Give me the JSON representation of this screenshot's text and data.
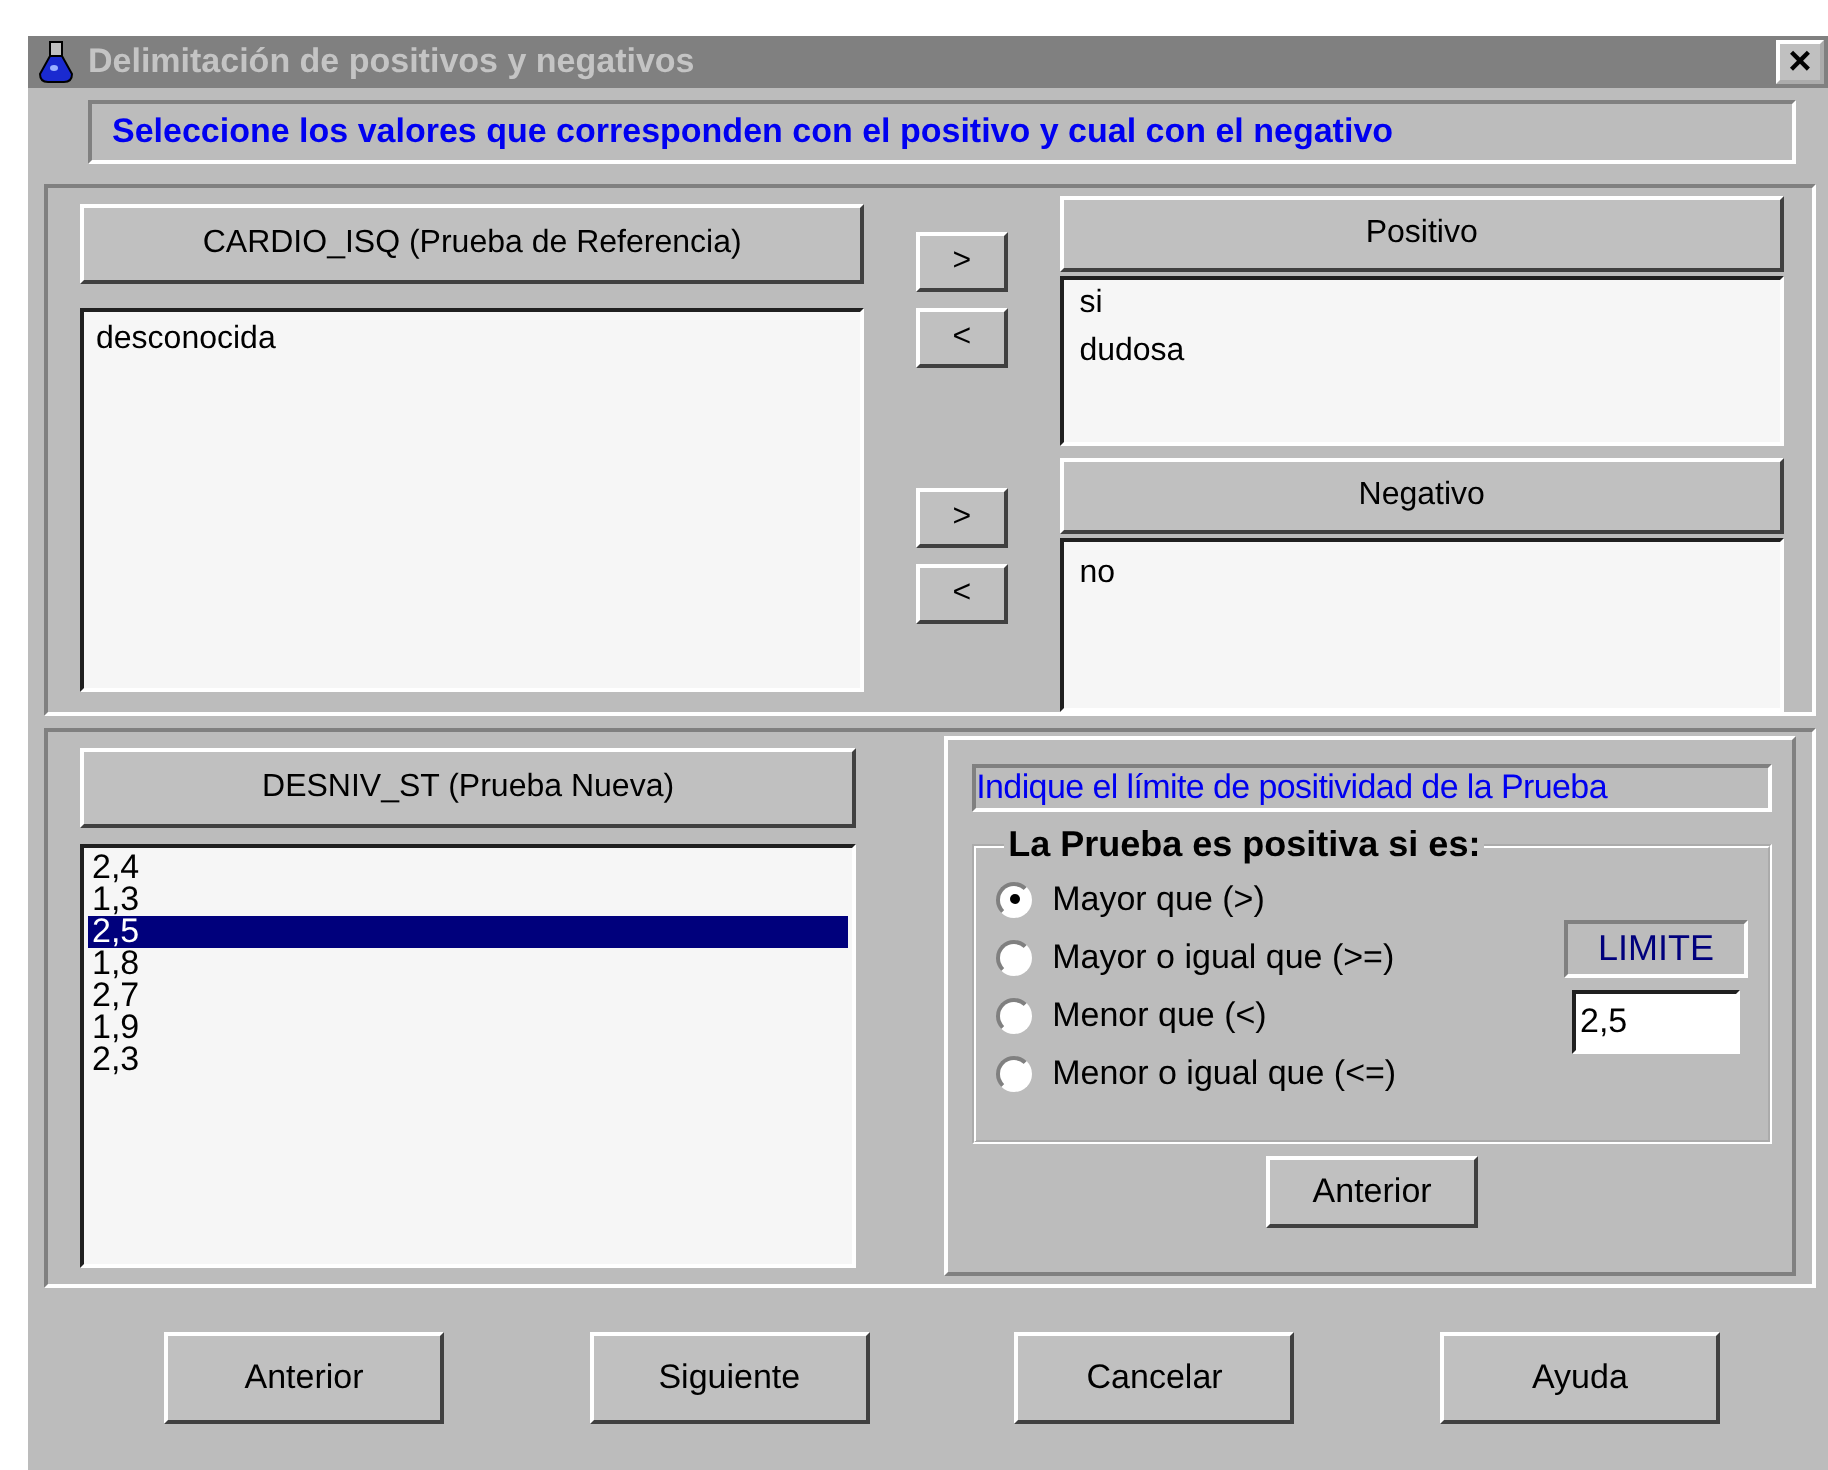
{
  "window": {
    "title": "Delimitación de positivos y negativos",
    "close": "×"
  },
  "instruction": "Seleccione los valores que corresponden con el positivo y cual con el negativo",
  "reference": {
    "header": "CARDIO_ISQ (Prueba de Referencia)",
    "items": [
      {
        "label": "desconocida",
        "selected": false
      }
    ]
  },
  "move_buttons": [
    ">",
    "<",
    ">",
    "<"
  ],
  "positive": {
    "header": "Positivo",
    "items": [
      {
        "label": "si",
        "selected": false
      },
      {
        "label": "dudosa",
        "selected": false
      }
    ]
  },
  "negative": {
    "header": "Negativo",
    "items": [
      {
        "label": "no",
        "selected": false
      }
    ]
  },
  "new_test": {
    "header": "DESNIV_ST (Prueba Nueva)",
    "items": [
      {
        "label": "2,4",
        "selected": false
      },
      {
        "label": "1,3",
        "selected": false
      },
      {
        "label": "2,5",
        "selected": true
      },
      {
        "label": "1,8",
        "selected": false
      },
      {
        "label": "2,7",
        "selected": false
      },
      {
        "label": "1,9",
        "selected": false
      },
      {
        "label": "2,3",
        "selected": false
      }
    ]
  },
  "limit_panel": {
    "title": "Indique el límite de positividad de la Prueba",
    "group": "La Prueba es positiva si es:",
    "options": [
      {
        "label": "Mayor que (>)",
        "selected": true
      },
      {
        "label": "Mayor o igual que (>=)",
        "selected": false
      },
      {
        "label": "Menor que (<)",
        "selected": false
      },
      {
        "label": "Menor o igual que (<=)",
        "selected": false
      }
    ],
    "limit_label": "LIMITE",
    "limit_value": "2,5",
    "button": "Anterior"
  },
  "buttons": [
    "Anterior",
    "Siguiente",
    "Cancelar",
    "Ayuda"
  ]
}
